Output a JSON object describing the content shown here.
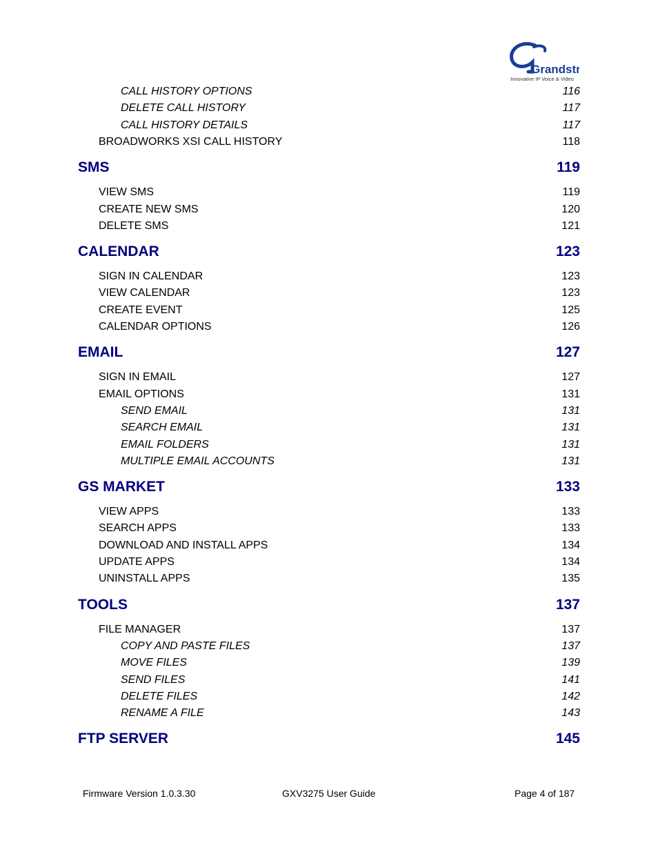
{
  "header": {
    "logo": {
      "brand": "Grandstream",
      "tagline": "Innovative IP Voice & Video",
      "color": "#1a3e96"
    }
  },
  "toc": [
    {
      "level": 3,
      "title": "CALL HISTORY OPTIONS",
      "page": "116"
    },
    {
      "level": 3,
      "title": "DELETE CALL HISTORY",
      "page": "117"
    },
    {
      "level": 3,
      "title": "CALL HISTORY DETAILS",
      "page": "117"
    },
    {
      "level": 2,
      "title": "BROADWORKS XSI CALL HISTORY",
      "page": "118"
    },
    {
      "level": 1,
      "title": "SMS",
      "page": "119"
    },
    {
      "level": 2,
      "title": "VIEW SMS",
      "page": "119"
    },
    {
      "level": 2,
      "title": "CREATE NEW SMS",
      "page": "120"
    },
    {
      "level": 2,
      "title": "DELETE SMS",
      "page": "121"
    },
    {
      "level": 1,
      "title": "CALENDAR",
      "page": "123"
    },
    {
      "level": 2,
      "title": "SIGN IN CALENDAR",
      "page": "123"
    },
    {
      "level": 2,
      "title": "VIEW CALENDAR",
      "page": "123"
    },
    {
      "level": 2,
      "title": "CREATE EVENT",
      "page": "125"
    },
    {
      "level": 2,
      "title": "CALENDAR OPTIONS",
      "page": "126"
    },
    {
      "level": 1,
      "title": "EMAIL",
      "page": "127"
    },
    {
      "level": 2,
      "title": "SIGN IN EMAIL",
      "page": "127"
    },
    {
      "level": 2,
      "title": "EMAIL OPTIONS",
      "page": "131"
    },
    {
      "level": 3,
      "title": "SEND EMAIL",
      "page": "131"
    },
    {
      "level": 3,
      "title": "SEARCH EMAIL",
      "page": "131"
    },
    {
      "level": 3,
      "title": "EMAIL FOLDERS",
      "page": "131"
    },
    {
      "level": 3,
      "title": "MULTIPLE EMAIL ACCOUNTS",
      "page": "131"
    },
    {
      "level": 1,
      "title": "GS MARKET",
      "page": "133"
    },
    {
      "level": 2,
      "title": "VIEW APPS",
      "page": "133"
    },
    {
      "level": 2,
      "title": "SEARCH APPS",
      "page": "133"
    },
    {
      "level": 2,
      "title": "DOWNLOAD AND INSTALL APPS",
      "page": "134"
    },
    {
      "level": 2,
      "title": "UPDATE APPS",
      "page": "134"
    },
    {
      "level": 2,
      "title": "UNINSTALL APPS",
      "page": "135"
    },
    {
      "level": 1,
      "title": "TOOLS",
      "page": "137"
    },
    {
      "level": 2,
      "title": "FILE MANAGER",
      "page": "137"
    },
    {
      "level": 3,
      "title": "COPY AND PASTE FILES",
      "page": "137"
    },
    {
      "level": 3,
      "title": "MOVE FILES",
      "page": "139"
    },
    {
      "level": 3,
      "title": "SEND FILES",
      "page": "141"
    },
    {
      "level": 3,
      "title": "DELETE FILES",
      "page": "142"
    },
    {
      "level": 3,
      "title": "RENAME A FILE",
      "page": "143"
    },
    {
      "level": 1,
      "title": "FTP SERVER",
      "page": "145"
    }
  ],
  "footer": {
    "firmware": "Firmware Version 1.0.3.30",
    "guide": "GXV3275 User Guide",
    "page": "Page 4 of 187"
  },
  "colors": {
    "heading": "#000080",
    "text": "#000000"
  }
}
